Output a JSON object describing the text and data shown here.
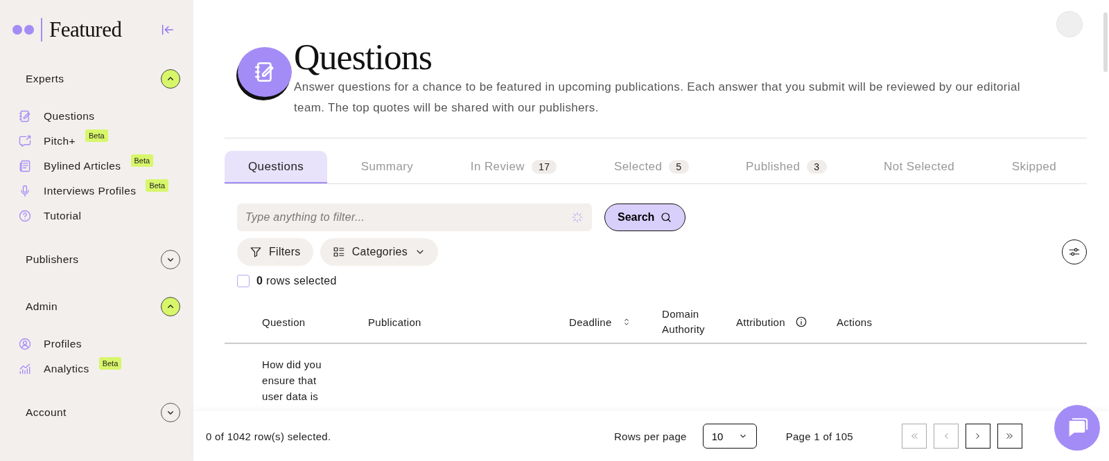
{
  "logo": {
    "text": "Featured"
  },
  "sidebar": {
    "sections": [
      {
        "title": "Experts",
        "expanded": true,
        "items": [
          {
            "label": "Questions"
          },
          {
            "label": "Pitch+",
            "badge": "Beta"
          },
          {
            "label": "Bylined Articles",
            "badge": "Beta"
          },
          {
            "label": "Interviews Profiles",
            "badge": "Beta"
          },
          {
            "label": "Tutorial"
          }
        ]
      },
      {
        "title": "Publishers",
        "expanded": false
      },
      {
        "title": "Admin",
        "expanded": true,
        "items": [
          {
            "label": "Profiles"
          },
          {
            "label": "Analytics",
            "badge": "Beta"
          }
        ]
      },
      {
        "title": "Account",
        "expanded": false
      }
    ]
  },
  "header": {
    "title": "Questions",
    "description": "Answer questions for a chance to be featured in upcoming publications. Each answer that you submit will be reviewed by our editorial team. The top quotes will be shared with our publishers."
  },
  "tabs": [
    {
      "label": "Questions",
      "selected": true
    },
    {
      "label": "Summary",
      "selected": false
    },
    {
      "label": "In Review",
      "count": "17",
      "selected": false
    },
    {
      "label": "Selected",
      "count": "5",
      "selected": false
    },
    {
      "label": "Published",
      "count": "3",
      "selected": false
    },
    {
      "label": "Not Selected",
      "selected": false
    },
    {
      "label": "Skipped",
      "selected": false
    }
  ],
  "search": {
    "placeholder": "Type anything to filter...",
    "button": "Search"
  },
  "filters": {
    "filters_button": "Filters",
    "categories_button": "Categories"
  },
  "selection": {
    "checked": false,
    "count": "0",
    "label": "rows selected"
  },
  "table": {
    "columns": [
      {
        "label": "Question",
        "kind": "plain"
      },
      {
        "label": "Publication",
        "kind": "plain"
      },
      {
        "label": "Deadline",
        "kind": "sortable"
      },
      {
        "label": "Domain Authority",
        "kind": "plain"
      },
      {
        "label": "Attribution",
        "kind": "info"
      },
      {
        "label": "Actions",
        "kind": "plain"
      }
    ],
    "rows": [
      {
        "question": "How did you ensure that user data is"
      }
    ]
  },
  "footer": {
    "selected_text": "0 of 1042 row(s) selected.",
    "rows_per_page_label": "Rows per page",
    "rows_per_page": "10",
    "page_text": "Page 1 of 105",
    "pager": [
      {
        "kind": "first",
        "disabled": true
      },
      {
        "kind": "prev",
        "disabled": true
      },
      {
        "kind": "next",
        "disabled": false
      },
      {
        "kind": "last",
        "disabled": false
      }
    ]
  }
}
